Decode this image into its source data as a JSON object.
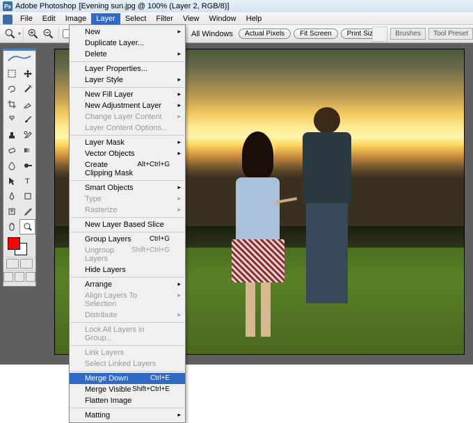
{
  "titlebar": {
    "app": "Adobe Photoshop",
    "doc": "[Evening sun.jpg @ 100% (Layer 2, RGB/8)]"
  },
  "menubar": {
    "items": [
      "File",
      "Edit",
      "Image",
      "Layer",
      "Select",
      "Filter",
      "View",
      "Window",
      "Help"
    ],
    "open_index": 3
  },
  "options": {
    "caption": "All Windows",
    "buttons": [
      "Actual Pixels",
      "Fit Screen",
      "Print Size"
    ],
    "right_tabs": [
      "Brushes",
      "Tool Preset"
    ]
  },
  "toolbox": {
    "fg_color": "#ff0000",
    "bg_color": "#ffffff"
  },
  "dropdown": {
    "groups": [
      [
        {
          "label": "New",
          "sub": true
        },
        {
          "label": "Duplicate Layer..."
        },
        {
          "label": "Delete",
          "sub": true
        }
      ],
      [
        {
          "label": "Layer Properties..."
        },
        {
          "label": "Layer Style",
          "sub": true
        }
      ],
      [
        {
          "label": "New Fill Layer",
          "sub": true
        },
        {
          "label": "New Adjustment Layer",
          "sub": true
        },
        {
          "label": "Change Layer Content",
          "sub": true,
          "disabled": true
        },
        {
          "label": "Layer Content Options...",
          "disabled": true
        }
      ],
      [
        {
          "label": "Layer Mask",
          "sub": true
        },
        {
          "label": "Vector Objects",
          "sub": true
        },
        {
          "label": "Create Clipping Mask",
          "shortcut": "Alt+Ctrl+G"
        }
      ],
      [
        {
          "label": "Smart Objects",
          "sub": true
        },
        {
          "label": "Type",
          "sub": true,
          "disabled": true
        },
        {
          "label": "Rasterize",
          "sub": true,
          "disabled": true
        }
      ],
      [
        {
          "label": "New Layer Based Slice"
        }
      ],
      [
        {
          "label": "Group Layers",
          "shortcut": "Ctrl+G"
        },
        {
          "label": "Ungroup Layers",
          "shortcut": "Shift+Ctrl+G",
          "disabled": true
        },
        {
          "label": "Hide Layers"
        }
      ],
      [
        {
          "label": "Arrange",
          "sub": true
        },
        {
          "label": "Align Layers To Selection",
          "sub": true,
          "disabled": true
        },
        {
          "label": "Distribute",
          "sub": true,
          "disabled": true
        }
      ],
      [
        {
          "label": "Lock All Layers in Group...",
          "disabled": true
        }
      ],
      [
        {
          "label": "Link Layers",
          "disabled": true
        },
        {
          "label": "Select Linked Layers",
          "disabled": true
        }
      ],
      [
        {
          "label": "Merge Down",
          "shortcut": "Ctrl+E",
          "highlight": true
        },
        {
          "label": "Merge Visible",
          "shortcut": "Shift+Ctrl+E"
        },
        {
          "label": "Flatten Image"
        }
      ],
      [
        {
          "label": "Matting",
          "sub": true
        }
      ]
    ]
  }
}
